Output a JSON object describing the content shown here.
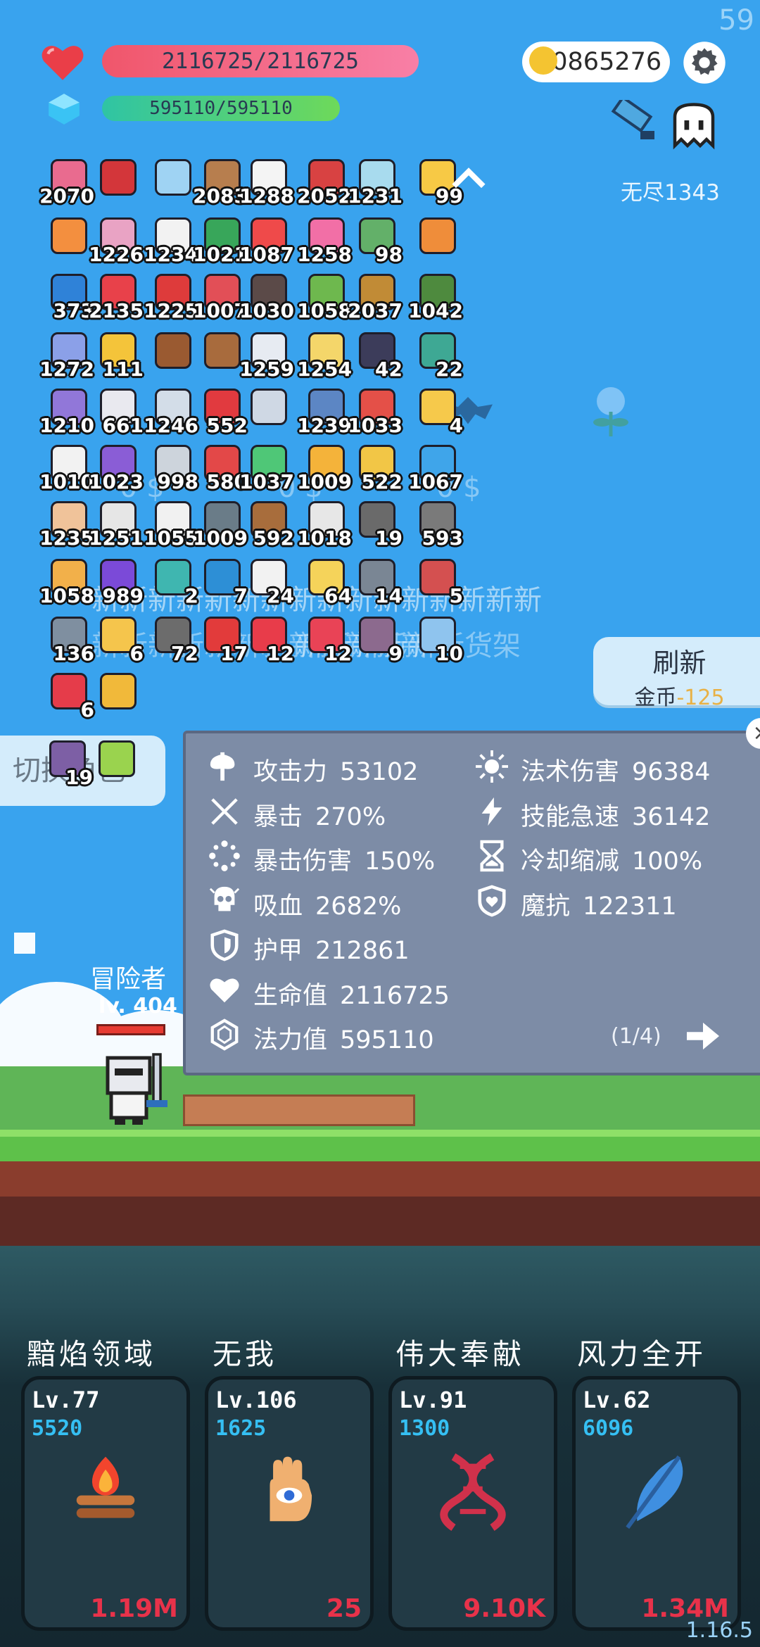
{
  "top": {
    "fps": "59",
    "hp_text": "2116725/2116725",
    "mp_text": "595110/595110",
    "coins": "10865276",
    "endless": "无尽1343",
    "version": "1.16.5"
  },
  "items": [
    {
      "c": "2070",
      "color": "#e96b8f"
    },
    {
      "c": "",
      "color": "#d3363a"
    },
    {
      "c": "",
      "color": "#9fd3f3"
    },
    {
      "c": "2083",
      "color": "#b77e4e"
    },
    {
      "c": "1288",
      "color": "#f4f4f4"
    },
    {
      "c": "2052",
      "color": "#d84242"
    },
    {
      "c": "1231",
      "color": "#a8dbee"
    },
    {
      "c": "99",
      "color": "#f7c945"
    },
    {
      "c": "",
      "color": "#f38f3f"
    },
    {
      "c": "1226",
      "color": "#e9a3c4"
    },
    {
      "c": "1234",
      "color": "#f2f2f2"
    },
    {
      "c": "1021",
      "color": "#38a65a"
    },
    {
      "c": "1087",
      "color": "#ef4a4a"
    },
    {
      "c": "1258",
      "color": "#f26fa6"
    },
    {
      "c": "98",
      "color": "#63b069"
    },
    {
      "c": "",
      "color": "#ef8d3a"
    },
    {
      "c": "373",
      "color": "#2f82d8"
    },
    {
      "c": "2135",
      "color": "#e8414a"
    },
    {
      "c": "1225",
      "color": "#de3b3b"
    },
    {
      "c": "1007",
      "color": "#e24f57"
    },
    {
      "c": "1030",
      "color": "#5b4a48"
    },
    {
      "c": "1058",
      "color": "#6eb84e"
    },
    {
      "c": "2037",
      "color": "#c18b36"
    },
    {
      "c": "1042",
      "color": "#4e8a3e"
    },
    {
      "c": "1272",
      "color": "#8ba0e8"
    },
    {
      "c": "111",
      "color": "#f4c43a"
    },
    {
      "c": "",
      "color": "#9a5a31"
    },
    {
      "c": "",
      "color": "#a86b3d"
    },
    {
      "c": "1259",
      "color": "#e7ebf2"
    },
    {
      "c": "1254",
      "color": "#f4d66a"
    },
    {
      "c": "42",
      "color": "#3c3c5a"
    },
    {
      "c": "22",
      "color": "#3ea894"
    },
    {
      "c": "1210",
      "color": "#9177d9"
    },
    {
      "c": "661",
      "color": "#e9e9ef"
    },
    {
      "c": "1246",
      "color": "#d3dde8"
    },
    {
      "c": "552",
      "color": "#e13a3f"
    },
    {
      "c": "",
      "color": "#cfd8e4"
    },
    {
      "c": "1239",
      "color": "#5c86c4"
    },
    {
      "c": "1033",
      "color": "#e45048"
    },
    {
      "c": "4",
      "color": "#f6c94b"
    },
    {
      "c": "1010",
      "color": "#f2f2f2"
    },
    {
      "c": "1023",
      "color": "#8a5dd6"
    },
    {
      "c": "998",
      "color": "#cdd4dc"
    },
    {
      "c": "580",
      "color": "#e34848"
    },
    {
      "c": "1037",
      "color": "#4fc777"
    },
    {
      "c": "1009",
      "color": "#f4b33a"
    },
    {
      "c": "522",
      "color": "#f2c646"
    },
    {
      "c": "1067",
      "color": "#3fa5ea"
    },
    {
      "c": "1235",
      "color": "#f0c39a"
    },
    {
      "c": "1251",
      "color": "#e6e6e6"
    },
    {
      "c": "1055",
      "color": "#f1f1f1"
    },
    {
      "c": "1009",
      "color": "#6a7c88"
    },
    {
      "c": "592",
      "color": "#a86d3c"
    },
    {
      "c": "1018",
      "color": "#e7e7e7"
    },
    {
      "c": "19",
      "color": "#6a6a6a"
    },
    {
      "c": "593",
      "color": "#7a7a7a"
    },
    {
      "c": "1058",
      "color": "#f2b04a"
    },
    {
      "c": "989",
      "color": "#7b4ad8"
    },
    {
      "c": "2",
      "color": "#3fb6b0"
    },
    {
      "c": "7",
      "color": "#2d8fd6"
    },
    {
      "c": "24",
      "color": "#f2f2f2"
    },
    {
      "c": "64",
      "color": "#f5d35a"
    },
    {
      "c": "14",
      "color": "#7a8694"
    },
    {
      "c": "5",
      "color": "#d45050"
    },
    {
      "c": "136",
      "color": "#7f8fa0"
    },
    {
      "c": "6",
      "color": "#f5c54c"
    },
    {
      "c": "72",
      "color": "#6c6c6c"
    },
    {
      "c": "17",
      "color": "#e23b3b"
    },
    {
      "c": "12",
      "color": "#e83c4a"
    },
    {
      "c": "12",
      "color": "#e94356"
    },
    {
      "c": "9",
      "color": "#8c6a8e"
    },
    {
      "c": "10",
      "color": "#8fc4ee"
    },
    {
      "c": "6",
      "color": "#e53c4a"
    },
    {
      "c": "",
      "color": "#f1b93a"
    }
  ],
  "overlay": {
    "money1": "0 $",
    "money2": "0 $",
    "money3": "0 $",
    "row1": "新新新新新新新新新新新新新新新新",
    "row2": "新新新新新新新新新新新新",
    "row3": "新新新新新新新新新新新新新",
    "row4": "新新新新新新货架",
    "row5": "新新新新新新新新新"
  },
  "refresh": {
    "title": "刷新",
    "coin_label": "金币",
    "coin_value": "-125"
  },
  "switch_label": "切换角色",
  "switch_items": [
    {
      "c": "19",
      "color": "#7d5fa5"
    },
    {
      "c": "",
      "color": "#9ad34e"
    }
  ],
  "attributes": {
    "left": [
      {
        "icon": "axe-icon",
        "label": "攻击力",
        "value": "53102"
      },
      {
        "icon": "crit-icon",
        "label": "暴击",
        "value": "270%"
      },
      {
        "icon": "crit-damage-icon",
        "label": "暴击伤害",
        "value": "150%"
      },
      {
        "icon": "skull-icon",
        "label": "吸血",
        "value": "2682%"
      },
      {
        "icon": "shield-icon",
        "label": "护甲",
        "value": "212861"
      },
      {
        "icon": "heart-icon",
        "label": "生命值",
        "value": "2116725"
      },
      {
        "icon": "mana-gem-icon",
        "label": "法力值",
        "value": "595110"
      }
    ],
    "right": [
      {
        "icon": "sun-icon",
        "label": "法术伤害",
        "value": "96384"
      },
      {
        "icon": "lightning-icon",
        "label": "技能急速",
        "value": "36142"
      },
      {
        "icon": "hourglass-icon",
        "label": "冷却缩减",
        "value": "100%"
      },
      {
        "icon": "magic-shield-icon",
        "label": "魔抗",
        "value": "122311"
      }
    ],
    "page": "(1/4)"
  },
  "character": {
    "name": "冒险者",
    "level": "lv. 404"
  },
  "skills": [
    {
      "name": "黯焰领域",
      "level": "Lv.77",
      "value": "5520",
      "cost": "1.19M",
      "icon": "campfire-icon"
    },
    {
      "name": "无我",
      "level": "Lv.106",
      "value": "1625",
      "cost": "25",
      "icon": "eye-hand-icon"
    },
    {
      "name": "伟大奉献",
      "level": "Lv.91",
      "value": "1300",
      "cost": "9.10K",
      "icon": "dna-icon"
    },
    {
      "name": "风力全开",
      "level": "Lv.62",
      "value": "6096",
      "cost": "1.34M",
      "icon": "feather-icon"
    }
  ]
}
